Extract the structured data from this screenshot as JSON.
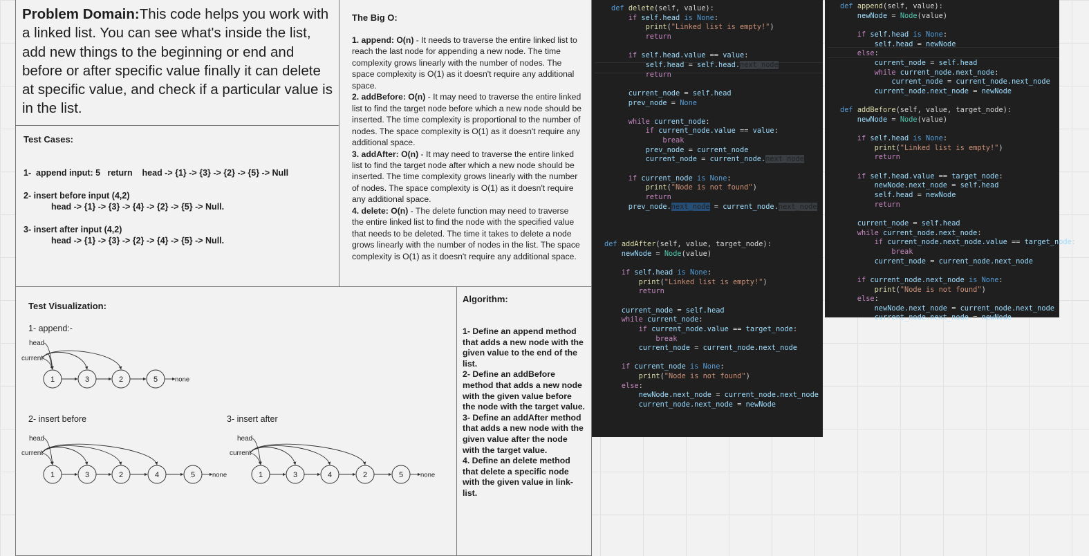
{
  "problem": {
    "label": "Problem Domain:",
    "text": "This code helps you work with a linked list. You can see what's inside the list, add new things to the beginning or end and before or after specific value finally it can delete at specific value, and check if a particular value is in the list."
  },
  "tests": {
    "title": "Test Cases:",
    "lines": [
      "1-  append input: 5   return    head -> {1} -> {3} -> {2} -> {5} -> Null",
      "2- insert before input (4,2)",
      "head -> {1} -> {3} -> {4} -> {2} -> {5} -> Null.",
      "3- insert after input (4,2)",
      "head -> {1} -> {3} -> {2} -> {4} -> {5} -> Null."
    ]
  },
  "bigo": {
    "title": "The Big O:",
    "items": [
      {
        "name": "1. append: O(n)",
        "text": " - It needs to traverse the entire linked list to reach the last node for appending a new node. The time complexity grows linearly with the number of nodes. The space complexity is O(1) as it doesn't require any additional space."
      },
      {
        "name": "2. addBefore: O(n)",
        "text": " - It may need to traverse the entire linked list to find the target node before which a new node should be inserted. The time complexity is proportional to the number of nodes. The space complexity is O(1) as it doesn't require any additional space."
      },
      {
        "name": "3. addAfter: O(n)",
        "text": " - It may need to traverse the entire linked list to find the target node after which a new node should be inserted. The time complexity grows linearly with the number of nodes. The space complexity is O(1) as it doesn't require any additional space."
      },
      {
        "name": "4. delete: O(n)",
        "text": " - The delete function may need to traverse the entire linked list to find the node with the specified value that needs to be deleted. The time it takes to delete a node grows linearly with the number of nodes in the list. The space complexity is O(1) as it doesn't require any additional space."
      }
    ]
  },
  "viz": {
    "title": "Test Visualization:",
    "append_label": "1- append:-",
    "before_label": "2- insert before",
    "after_label": "3- insert after",
    "head": "head",
    "current": "current",
    "none": "none",
    "append_nodes": [
      "1",
      "3",
      "2",
      "5"
    ],
    "before_nodes": [
      "1",
      "3",
      "2",
      "4",
      "5"
    ],
    "after_nodes": [
      "1",
      "3",
      "4",
      "2",
      "5"
    ]
  },
  "algo": {
    "title": "Algorithm:",
    "text": "1- Define an append method that adds a new node with the given value to the end of the list.\n2- Define an addBefore method that adds a new node with the given value before the node with the target value.\n3- Define an addAfter method that adds a new node with the given value after the node with the target value.\n4. Define an delete method that delete a specific node with the given value in link-list."
  },
  "code": {
    "delete": [
      [
        [
          "def ",
          "d"
        ],
        [
          "delete",
          "f"
        ],
        [
          "(self, value):",
          "o"
        ]
      ],
      [
        [
          "    if ",
          "k"
        ],
        [
          "self",
          "v"
        ],
        [
          ".head ",
          "v"
        ],
        [
          "is ",
          "d"
        ],
        [
          "None",
          "d"
        ],
        [
          ":",
          "o"
        ]
      ],
      [
        [
          "        print",
          "f"
        ],
        [
          "(",
          "o"
        ],
        [
          "\"Linked list is empty!\"",
          "s"
        ],
        [
          ")",
          "o"
        ]
      ],
      [
        [
          "        return",
          "k"
        ]
      ],
      [
        [
          "",
          ""
        ]
      ],
      [
        [
          "    if ",
          "k"
        ],
        [
          "self",
          "v"
        ],
        [
          ".head.value ",
          "v"
        ],
        [
          "== ",
          "o"
        ],
        [
          "value",
          "v"
        ],
        [
          ":",
          "o"
        ]
      ],
      [
        [
          "        self",
          "v"
        ],
        [
          ".head ",
          "v"
        ],
        [
          "= ",
          "o"
        ],
        [
          "self",
          "v"
        ],
        [
          ".head.",
          "v"
        ],
        [
          "next_node",
          "hl2"
        ]
      ],
      [
        [
          "        return",
          "k"
        ]
      ],
      [
        [
          "",
          ""
        ]
      ],
      [
        [
          "    current_node ",
          "v"
        ],
        [
          "= ",
          "o"
        ],
        [
          "self",
          "v"
        ],
        [
          ".head",
          "v"
        ]
      ],
      [
        [
          "    prev_node ",
          "v"
        ],
        [
          "= ",
          "o"
        ],
        [
          "None",
          "d"
        ]
      ],
      [
        [
          "",
          ""
        ]
      ],
      [
        [
          "    while ",
          "k"
        ],
        [
          "current_node",
          "v"
        ],
        [
          ":",
          "o"
        ]
      ],
      [
        [
          "        if ",
          "k"
        ],
        [
          "current_node",
          "v"
        ],
        [
          ".value ",
          "v"
        ],
        [
          "== ",
          "o"
        ],
        [
          "value",
          "v"
        ],
        [
          ":",
          "o"
        ]
      ],
      [
        [
          "            break",
          "k"
        ]
      ],
      [
        [
          "        prev_node ",
          "v"
        ],
        [
          "= ",
          "o"
        ],
        [
          "current_node",
          "v"
        ]
      ],
      [
        [
          "        current_node ",
          "v"
        ],
        [
          "= ",
          "o"
        ],
        [
          "current_node.",
          "v"
        ],
        [
          "next_node",
          "hl2"
        ]
      ],
      [
        [
          "",
          ""
        ]
      ],
      [
        [
          "    if ",
          "k"
        ],
        [
          "current_node ",
          "v"
        ],
        [
          "is ",
          "d"
        ],
        [
          "None",
          "d"
        ],
        [
          ":",
          "o"
        ]
      ],
      [
        [
          "        print",
          "f"
        ],
        [
          "(",
          "o"
        ],
        [
          "\"Node is not found\"",
          "s"
        ],
        [
          ")",
          "o"
        ]
      ],
      [
        [
          "        return",
          "k"
        ]
      ],
      [
        [
          "    prev_node.",
          "v"
        ],
        [
          "next_node",
          "hl"
        ],
        [
          " = ",
          "o"
        ],
        [
          "current_node.",
          "v"
        ],
        [
          "next_node",
          "hl2"
        ]
      ]
    ],
    "addafter": [
      [
        [
          "def ",
          "d"
        ],
        [
          "addAfter",
          "f"
        ],
        [
          "(self, value, target_node):",
          "o"
        ]
      ],
      [
        [
          "    newNode ",
          "v"
        ],
        [
          "= ",
          "o"
        ],
        [
          "Node",
          "c"
        ],
        [
          "(value)",
          "o"
        ]
      ],
      [
        [
          "",
          ""
        ]
      ],
      [
        [
          "    if ",
          "k"
        ],
        [
          "self",
          "v"
        ],
        [
          ".head ",
          "v"
        ],
        [
          "is ",
          "d"
        ],
        [
          "None",
          "d"
        ],
        [
          ":",
          "o"
        ]
      ],
      [
        [
          "        print",
          "f"
        ],
        [
          "(",
          "o"
        ],
        [
          "\"Linked list is empty!\"",
          "s"
        ],
        [
          ")",
          "o"
        ]
      ],
      [
        [
          "        return",
          "k"
        ]
      ],
      [
        [
          "",
          ""
        ]
      ],
      [
        [
          "    current_node ",
          "v"
        ],
        [
          "= ",
          "o"
        ],
        [
          "self",
          "v"
        ],
        [
          ".head",
          "v"
        ]
      ],
      [
        [
          "    while ",
          "k"
        ],
        [
          "current_node",
          "v"
        ],
        [
          ":",
          "o"
        ]
      ],
      [
        [
          "        if ",
          "k"
        ],
        [
          "current_node",
          "v"
        ],
        [
          ".value ",
          "v"
        ],
        [
          "== ",
          "o"
        ],
        [
          "target_node",
          "v"
        ],
        [
          ":",
          "o"
        ]
      ],
      [
        [
          "            break",
          "k"
        ]
      ],
      [
        [
          "        current_node ",
          "v"
        ],
        [
          "= ",
          "o"
        ],
        [
          "current_node.next_node",
          "v"
        ]
      ],
      [
        [
          "",
          ""
        ]
      ],
      [
        [
          "    if ",
          "k"
        ],
        [
          "current_node ",
          "v"
        ],
        [
          "is ",
          "d"
        ],
        [
          "None",
          "d"
        ],
        [
          ":",
          "o"
        ]
      ],
      [
        [
          "        print",
          "f"
        ],
        [
          "(",
          "o"
        ],
        [
          "\"Node is not found\"",
          "s"
        ],
        [
          ")",
          "o"
        ]
      ],
      [
        [
          "    else",
          "k"
        ],
        [
          ":",
          "o"
        ]
      ],
      [
        [
          "        newNode.next_node ",
          "v"
        ],
        [
          "= ",
          "o"
        ],
        [
          "current_node.next_node",
          "v"
        ]
      ],
      [
        [
          "        current_node.next_node ",
          "v"
        ],
        [
          "= ",
          "o"
        ],
        [
          "newNode",
          "v"
        ]
      ]
    ],
    "append": [
      [
        [
          "def ",
          "d"
        ],
        [
          "append",
          "f"
        ],
        [
          "(self, value):",
          "o"
        ]
      ],
      [
        [
          "    newNode ",
          "v"
        ],
        [
          "= ",
          "o"
        ],
        [
          "Node",
          "c"
        ],
        [
          "(value)",
          "o"
        ]
      ],
      [
        [
          "",
          ""
        ]
      ],
      [
        [
          "    if ",
          "k"
        ],
        [
          "self",
          "v"
        ],
        [
          ".head ",
          "v"
        ],
        [
          "is ",
          "d"
        ],
        [
          "None",
          "d"
        ],
        [
          ":",
          "o"
        ]
      ],
      [
        [
          "        self",
          "v"
        ],
        [
          ".head ",
          "v"
        ],
        [
          "= ",
          "o"
        ],
        [
          "newNode",
          "v"
        ]
      ],
      [
        [
          "    else",
          "k"
        ],
        [
          ":",
          "o"
        ]
      ],
      [
        [
          "        current_node ",
          "v"
        ],
        [
          "= ",
          "o"
        ],
        [
          "self",
          "v"
        ],
        [
          ".head",
          "v"
        ]
      ],
      [
        [
          "        while ",
          "k"
        ],
        [
          "current_node.next_node",
          "v"
        ],
        [
          ":",
          "o"
        ]
      ],
      [
        [
          "            current_node ",
          "v"
        ],
        [
          "= ",
          "o"
        ],
        [
          "current_node.next_node",
          "v"
        ]
      ],
      [
        [
          "        current_node.next_node ",
          "v"
        ],
        [
          "= ",
          "o"
        ],
        [
          "newNode",
          "v"
        ]
      ],
      [
        [
          "",
          ""
        ]
      ],
      [
        [
          "def ",
          "d"
        ],
        [
          "addBefore",
          "f"
        ],
        [
          "(self, value, target_node):",
          "o"
        ]
      ],
      [
        [
          "    newNode ",
          "v"
        ],
        [
          "= ",
          "o"
        ],
        [
          "Node",
          "c"
        ],
        [
          "(value)",
          "o"
        ]
      ],
      [
        [
          "",
          ""
        ]
      ],
      [
        [
          "    if ",
          "k"
        ],
        [
          "self",
          "v"
        ],
        [
          ".head ",
          "v"
        ],
        [
          "is ",
          "d"
        ],
        [
          "None",
          "d"
        ],
        [
          ":",
          "o"
        ]
      ],
      [
        [
          "        print",
          "f"
        ],
        [
          "(",
          "o"
        ],
        [
          "\"Linked list is empty!\"",
          "s"
        ],
        [
          ")",
          "o"
        ]
      ],
      [
        [
          "        return",
          "k"
        ]
      ],
      [
        [
          "",
          ""
        ]
      ],
      [
        [
          "    if ",
          "k"
        ],
        [
          "self",
          "v"
        ],
        [
          ".head.value ",
          "v"
        ],
        [
          "== ",
          "o"
        ],
        [
          "target_node",
          "v"
        ],
        [
          ":",
          "o"
        ]
      ],
      [
        [
          "        newNode.next_node ",
          "v"
        ],
        [
          "= ",
          "o"
        ],
        [
          "self",
          "v"
        ],
        [
          ".head",
          "v"
        ]
      ],
      [
        [
          "        self",
          "v"
        ],
        [
          ".head ",
          "v"
        ],
        [
          "= ",
          "o"
        ],
        [
          "newNode",
          "v"
        ]
      ],
      [
        [
          "        return",
          "k"
        ]
      ],
      [
        [
          "",
          ""
        ]
      ],
      [
        [
          "    current_node ",
          "v"
        ],
        [
          "= ",
          "o"
        ],
        [
          "self",
          "v"
        ],
        [
          ".head",
          "v"
        ]
      ],
      [
        [
          "    while ",
          "k"
        ],
        [
          "current_node.next_node",
          "v"
        ],
        [
          ":",
          "o"
        ]
      ],
      [
        [
          "        if ",
          "k"
        ],
        [
          "current_node.next_node.value ",
          "v"
        ],
        [
          "== ",
          "o"
        ],
        [
          "target_node",
          "v"
        ],
        [
          ":",
          "o"
        ]
      ],
      [
        [
          "            break",
          "k"
        ]
      ],
      [
        [
          "        current_node ",
          "v"
        ],
        [
          "= ",
          "o"
        ],
        [
          "current_node.next_node",
          "v"
        ]
      ],
      [
        [
          "",
          ""
        ]
      ],
      [
        [
          "    if ",
          "k"
        ],
        [
          "current_node.next_node ",
          "v"
        ],
        [
          "is ",
          "d"
        ],
        [
          "None",
          "d"
        ],
        [
          ":",
          "o"
        ]
      ],
      [
        [
          "        print",
          "f"
        ],
        [
          "(",
          "o"
        ],
        [
          "\"Node is not found\"",
          "s"
        ],
        [
          ")",
          "o"
        ]
      ],
      [
        [
          "    else",
          "k"
        ],
        [
          ":",
          "o"
        ]
      ],
      [
        [
          "        newNode.next_node ",
          "v"
        ],
        [
          "= ",
          "o"
        ],
        [
          "current_node.next_node",
          "v"
        ]
      ],
      [
        [
          "        current_node.next_node ",
          "v"
        ],
        [
          "= ",
          "o"
        ],
        [
          "newNode",
          "v"
        ]
      ]
    ]
  }
}
